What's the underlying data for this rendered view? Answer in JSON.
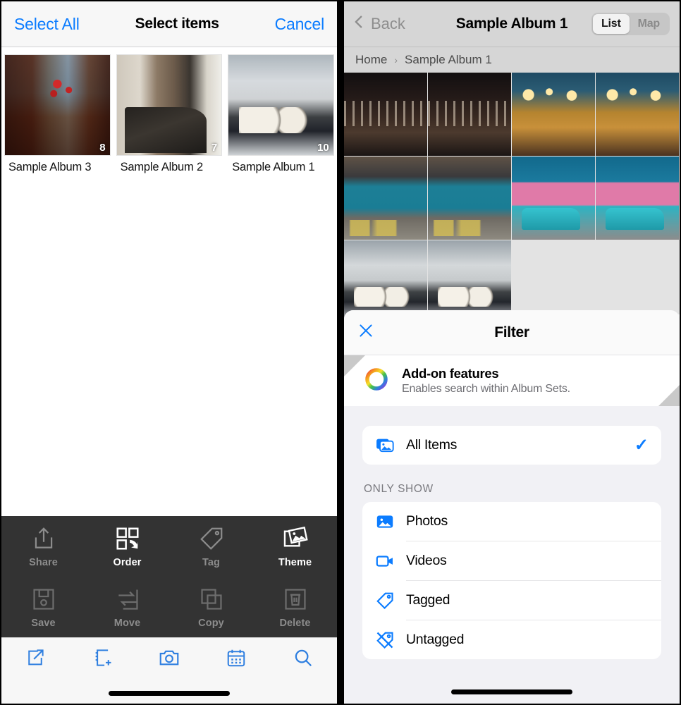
{
  "left": {
    "navbar": {
      "select_all": "Select All",
      "title": "Select items",
      "cancel": "Cancel"
    },
    "albums": [
      {
        "name": "Sample Album 3",
        "count": "8",
        "art": "art-alley"
      },
      {
        "name": "Sample Album 2",
        "count": "7",
        "art": "art-room"
      },
      {
        "name": "Sample Album 1",
        "count": "10",
        "art": "art-car"
      }
    ],
    "actions_row1": [
      {
        "label": "Share",
        "icon": "share-icon",
        "enabled": false
      },
      {
        "label": "Order",
        "icon": "order-icon",
        "enabled": true
      },
      {
        "label": "Tag",
        "icon": "tag-icon",
        "enabled": false
      },
      {
        "label": "Theme",
        "icon": "theme-icon",
        "enabled": true
      }
    ],
    "actions_row2": [
      {
        "label": "Save",
        "icon": "save-icon",
        "enabled": false
      },
      {
        "label": "Move",
        "icon": "move-icon",
        "enabled": false
      },
      {
        "label": "Copy",
        "icon": "copy-icon",
        "enabled": false
      },
      {
        "label": "Delete",
        "icon": "delete-icon",
        "enabled": false
      }
    ],
    "tabbar": [
      {
        "icon": "share-export-icon"
      },
      {
        "icon": "new-album-icon"
      },
      {
        "icon": "camera-icon"
      },
      {
        "icon": "calendar-icon"
      },
      {
        "icon": "search-icon"
      }
    ]
  },
  "right": {
    "navbar": {
      "back": "Back",
      "title": "Sample Album 1",
      "segments": [
        {
          "label": "List",
          "selected": true
        },
        {
          "label": "Map",
          "selected": false
        }
      ]
    },
    "breadcrumb": {
      "home": "Home",
      "separator": "›",
      "current": "Sample Album 1"
    },
    "grid": [
      "ph-night",
      "ph-night",
      "ph-market",
      "ph-market",
      "ph-bluecar",
      "ph-bluecar",
      "ph-pink",
      "ph-pink",
      "ph-silvercar",
      "ph-silvercar"
    ],
    "filter_sheet": {
      "close_icon": "close-icon",
      "title": "Filter",
      "addon": {
        "icon": "color-ring-icon",
        "title": "Add-on features",
        "subtitle": "Enables search within Album Sets."
      },
      "all_items": {
        "icon": "all-items-icon",
        "label": "All Items",
        "checked": true,
        "check_glyph": "✓"
      },
      "section_label": "ONLY SHOW",
      "only_show": [
        {
          "icon": "photo-icon",
          "label": "Photos"
        },
        {
          "icon": "video-icon",
          "label": "Videos"
        },
        {
          "icon": "tag-icon",
          "label": "Tagged"
        },
        {
          "icon": "untagged-icon",
          "label": "Untagged"
        }
      ]
    }
  },
  "colors": {
    "accent_blue": "#0b7cff",
    "toolbar_dark": "#333333",
    "sheet_bg": "#f1f1f5",
    "navbar_gray": "#d6d6d6"
  }
}
